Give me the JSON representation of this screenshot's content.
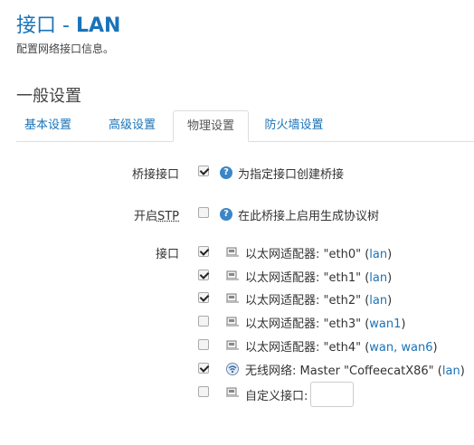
{
  "header": {
    "title_prefix": "接口 - ",
    "title_name": "LAN",
    "description": "配置网络接口信息。"
  },
  "section": {
    "title": "一般设置"
  },
  "tabs": [
    {
      "label": "基本设置"
    },
    {
      "label": "高级设置"
    },
    {
      "label": "物理设置"
    },
    {
      "label": "防火墙设置"
    }
  ],
  "bridge": {
    "label": "桥接接口",
    "checked": true,
    "help": "为指定接口创建桥接"
  },
  "stp": {
    "label_prefix": "开启",
    "label_abbr": "STP",
    "checked": false,
    "help": "在此桥接上启用生成协议树"
  },
  "interfaces": {
    "label": "接口",
    "items": [
      {
        "prefix": "以太网适配器: \"eth0\" (",
        "zone": "lan",
        "suffix": ")",
        "checked": true,
        "icon": "ethernet-icon"
      },
      {
        "prefix": "以太网适配器: \"eth1\" (",
        "zone": "lan",
        "suffix": ")",
        "checked": true,
        "icon": "ethernet-icon"
      },
      {
        "prefix": "以太网适配器: \"eth2\" (",
        "zone": "lan",
        "suffix": ")",
        "checked": true,
        "icon": "ethernet-icon"
      },
      {
        "prefix": "以太网适配器: \"eth3\" (",
        "zone": "wan1",
        "suffix": ")",
        "checked": false,
        "icon": "ethernet-icon"
      },
      {
        "prefix": "以太网适配器: \"eth4\" (",
        "zone": "wan, wan6",
        "suffix": ")",
        "checked": false,
        "icon": "ethernet-icon"
      },
      {
        "prefix": "无线网络: Master \"CoffeecatX86\" (",
        "zone": "lan",
        "suffix": ")",
        "checked": true,
        "icon": "wireless-icon"
      }
    ],
    "custom": {
      "label": "自定义接口:",
      "checked": false,
      "value": ""
    }
  }
}
